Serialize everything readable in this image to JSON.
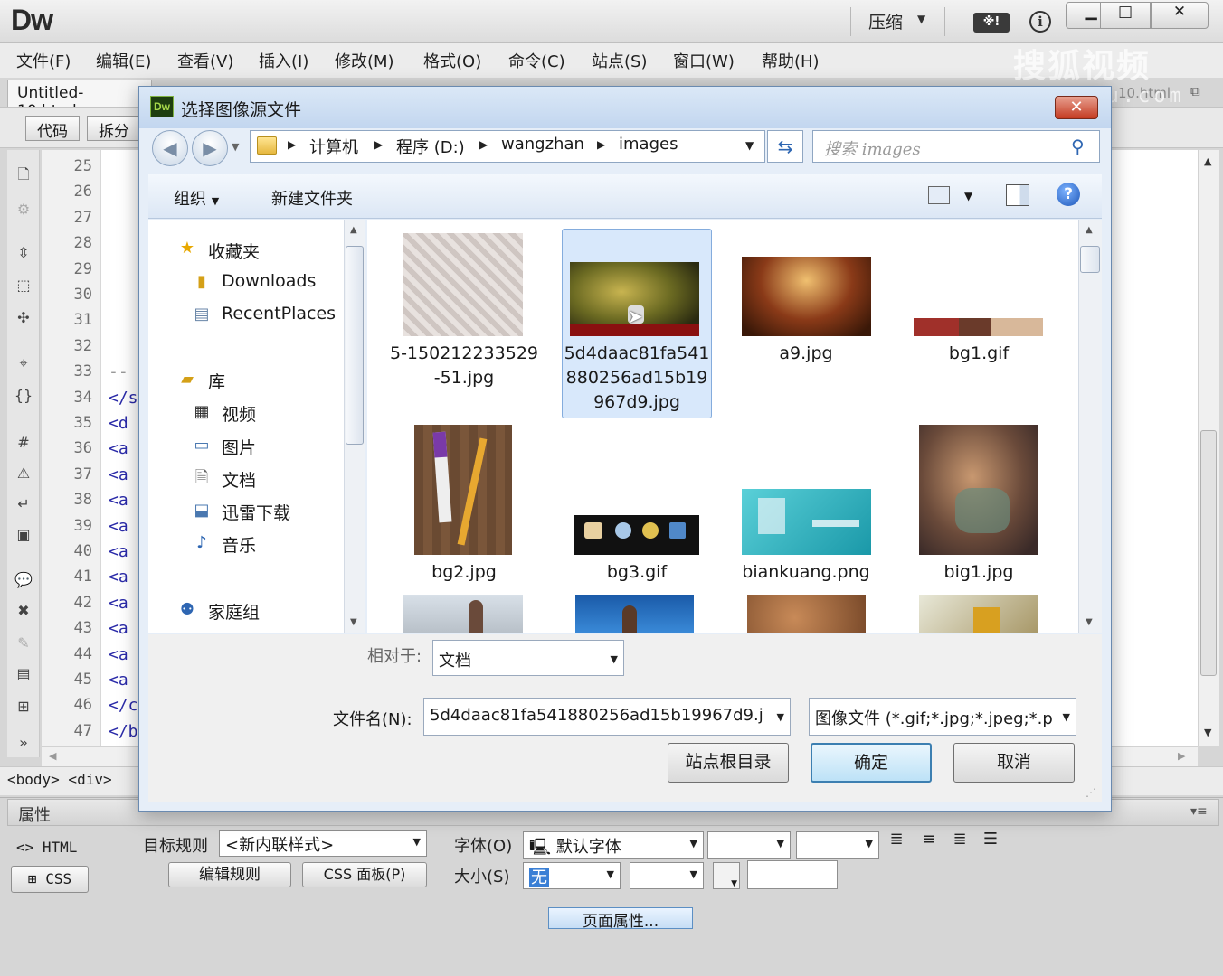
{
  "app": {
    "logo": "Dw",
    "compress_label": "压缩",
    "ext_label": "※!",
    "info_label": "i",
    "window_controls": [
      "▁",
      "□",
      "✕"
    ]
  },
  "menu": [
    "文件(F)",
    "编辑(E)",
    "查看(V)",
    "插入(I)",
    "修改(M)",
    "格式(O)",
    "命令(C)",
    "站点(S)",
    "窗口(W)",
    "帮助(H)"
  ],
  "document": {
    "tab": "Untitled-10.html",
    "right_tab": "10.html",
    "view_buttons": [
      "代码",
      "拆分"
    ],
    "line_numbers": [
      "25",
      "26",
      "27",
      "28",
      "29",
      "30",
      "31",
      "32",
      "33",
      "34",
      "35",
      "36",
      "37",
      "38",
      "39",
      "40",
      "41",
      "42",
      "43",
      "44",
      "45",
      "46",
      "47"
    ],
    "code_fragments": [
      "--",
      "</s",
      "<d",
      "<a",
      "<a",
      "<a",
      "<a",
      "<a",
      "<a",
      "<a",
      "<a",
      "<a",
      "<a",
      "</c",
      "</b"
    ],
    "tag_selector": "<body> <div>"
  },
  "properties": {
    "title": "属性",
    "html_label": "HTML",
    "css_label": "CSS",
    "target_rule_label": "目标规则",
    "target_rule_value": "<新内联样式>",
    "edit_rule_btn": "编辑规则",
    "css_panel_btn": "CSS 面板(P)",
    "font_label": "字体(O)",
    "font_value": "默认字体",
    "size_label": "大小(S)",
    "size_value": "无",
    "page_props_btn": "页面属性..."
  },
  "dialog": {
    "logo": "Dw",
    "title": "选择图像源文件",
    "breadcrumbs": [
      "计算机",
      "程序 (D:)",
      "wangzhan",
      "images"
    ],
    "search_placeholder": "搜索 images",
    "organize": "组织",
    "new_folder": "新建文件夹",
    "help": "?",
    "nav": {
      "favorites": "收藏夹",
      "downloads": "Downloads",
      "recent": "RecentPlaces",
      "library": "库",
      "videos": "视频",
      "pictures": "图片",
      "documents": "文档",
      "xunlei": "迅雷下载",
      "music": "音乐",
      "homegroup": "家庭组"
    },
    "files": [
      {
        "name": "5-150212233529-51.jpg"
      },
      {
        "name": "5d4daac81fa541880256ad15b19967d9.jpg"
      },
      {
        "name": "a9.jpg"
      },
      {
        "name": "bg1.gif"
      },
      {
        "name": "bg2.jpg"
      },
      {
        "name": "bg3.gif"
      },
      {
        "name": "biankuang.png"
      },
      {
        "name": "big1.jpg"
      }
    ],
    "relative_label": "相对于:",
    "relative_value": "文档",
    "filename_label": "文件名(N):",
    "filename_value": "5d4daac81fa541880256ad15b19967d9.j",
    "filetype_value": "图像文件 (*.gif;*.jpg;*.jpeg;*.p",
    "site_root_btn": "站点根目录",
    "ok_btn": "确定",
    "cancel_btn": "取消"
  },
  "watermark": {
    "main": "搜狐视频",
    "sub": "tv.sohu.com"
  }
}
